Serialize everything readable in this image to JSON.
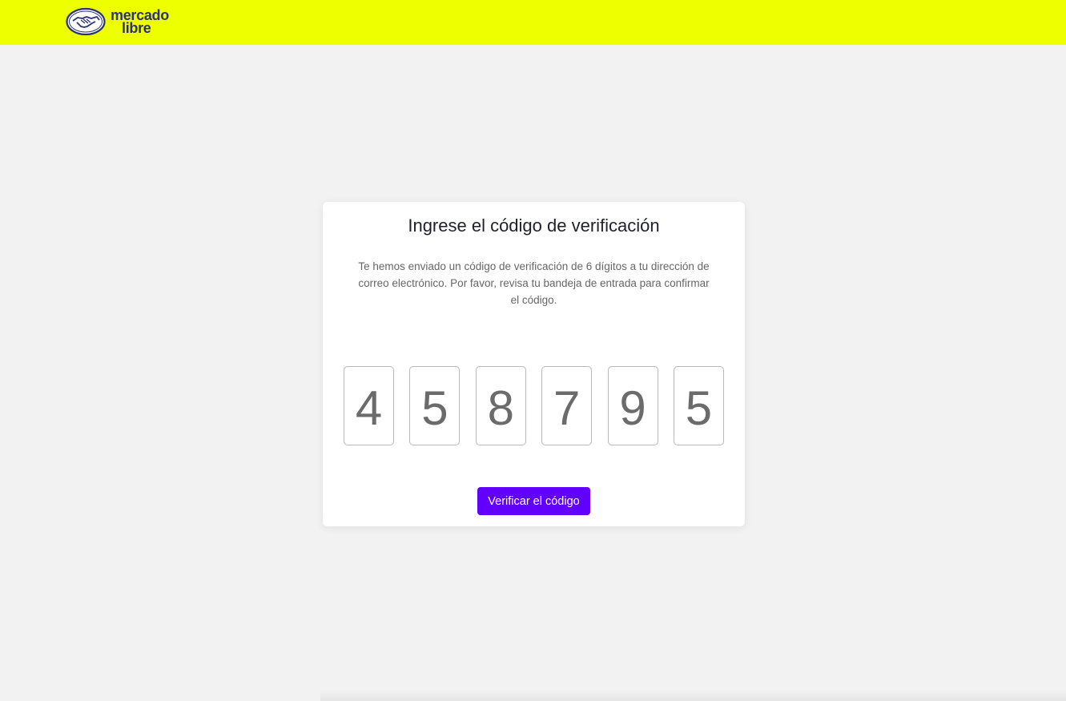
{
  "header": {
    "logo_line1": "mercado",
    "logo_line2": "libre",
    "background_color": "#eeff00"
  },
  "card": {
    "title": "Ingrese el código de verificación",
    "description": "Te hemos enviado un código de verificación de 6 dígitos a tu dirección de correo electrónico. Por favor, revisa tu bandeja de entrada para confirmar el código.",
    "code_digits": [
      "4",
      "5",
      "8",
      "7",
      "9",
      "5"
    ],
    "verify_button_label": "Verificar el código",
    "button_color": "#6200ff"
  }
}
